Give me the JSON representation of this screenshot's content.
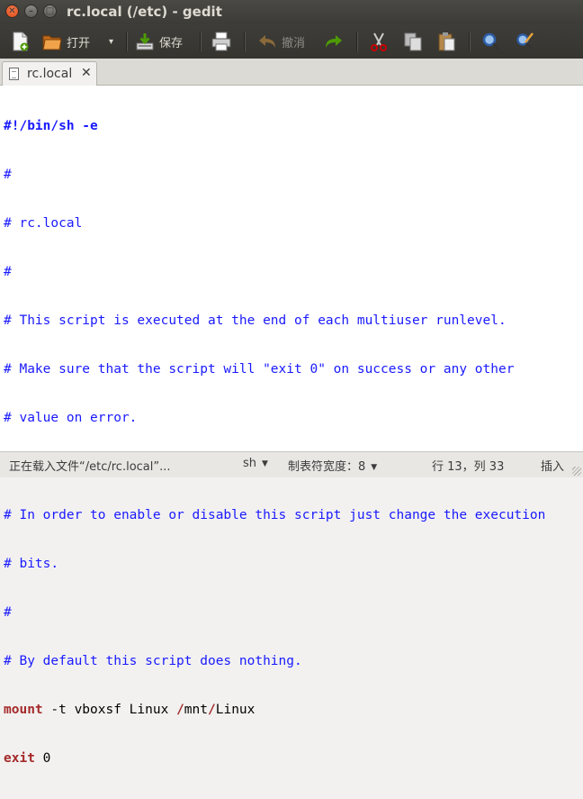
{
  "window": {
    "title": "rc.local (/etc) - gedit",
    "close_glyph": "✕",
    "min_glyph": "–",
    "max_glyph": "□"
  },
  "toolbar": {
    "new_icon": "new-document-icon",
    "open_label": "打开",
    "open_menu_glyph": "▾",
    "save_label": "保存",
    "print_icon": "printer-icon",
    "undo_label": "撤消",
    "redo_icon": "redo-icon",
    "cut_icon": "scissors-icon",
    "copy_icon": "copy-icon",
    "paste_icon": "paste-icon",
    "find_icon": "magnifier-icon",
    "replace_icon": "find-replace-icon"
  },
  "tab": {
    "label": "rc.local",
    "close_glyph": "✕"
  },
  "editor": {
    "line1": "#!/bin/sh -e",
    "line2": "#",
    "line3": "# rc.local",
    "line4": "#",
    "line5": "# This script is executed at the end of each multiuser runlevel.",
    "line6": "# Make sure that the script will \"exit 0\" on success or any other",
    "line7": "# value on error.",
    "line8": "#",
    "line9": "# In order to enable or disable this script just change the execution",
    "line10": "# bits.",
    "line11": "#",
    "line12": "# By default this script does nothing.",
    "line13_kw": "mount",
    "line13_a": " -t vboxsf Linux ",
    "line13_s1": "/",
    "line13_b": "mnt",
    "line13_s2": "/",
    "line13_c": "Linux",
    "line14_kw": "exit",
    "line14_rest": " 0"
  },
  "status": {
    "message": "正在载入文件“/etc/rc.local”...",
    "language": "sh",
    "tab_width": "制表符宽度：8",
    "position": "行 13，列 33",
    "mode": "插入",
    "dropdown_glyph": "▼"
  },
  "colors": {
    "comment": "#1a1aff",
    "keyword": "#a52a2a",
    "title_bar": "#3c3b37"
  }
}
